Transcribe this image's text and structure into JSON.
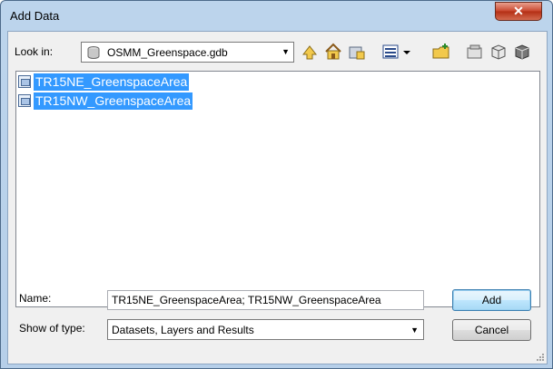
{
  "window": {
    "title": "Add Data",
    "close_symbol": "✕"
  },
  "toolbar": {
    "look_in_label": "Look in:",
    "look_in_value": "OSMM_Greenspace.gdb",
    "buttons": [
      "up-one-level-icon",
      "home-icon",
      "connect-folder-icon",
      "view-list-icon",
      "new-folder-icon",
      "catalog-icon-1",
      "catalog-icon-2",
      "catalog-icon-3"
    ]
  },
  "files": [
    {
      "name": "TR15NE_GreenspaceArea",
      "selected": true
    },
    {
      "name": "TR15NW_GreenspaceArea",
      "selected": true
    }
  ],
  "form": {
    "name_label": "Name:",
    "name_value": "TR15NE_GreenspaceArea; TR15NW_GreenspaceArea",
    "type_label": "Show of type:",
    "type_value": "Datasets, Layers and Results"
  },
  "buttons": {
    "add": "Add",
    "cancel": "Cancel"
  },
  "colors": {
    "selection": "#3399ff",
    "title_bar": "#bcd4ec",
    "close_button": "#c8452c"
  }
}
